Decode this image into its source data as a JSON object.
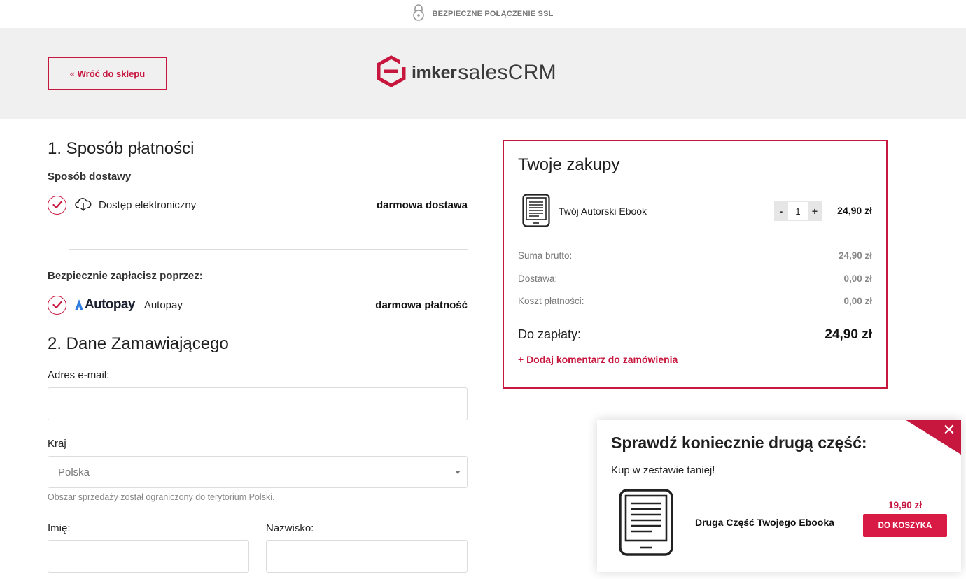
{
  "topbar": {
    "ssl_text": "BEZPIECZNE POŁĄCZENIE SSL",
    "icon": "padlock-icon"
  },
  "header": {
    "back_label": "« Wróć do sklepu",
    "logo_text_a": "imker",
    "logo_text_b": "salesCRM",
    "brand_color": "#c8173f"
  },
  "payment_section": {
    "title": "1. Sposób płatności",
    "delivery_label": "Sposób dostawy",
    "delivery_option": {
      "label": "Dostęp elektroniczny",
      "price": "darmowa dostawa",
      "icon": "cloud-download-icon"
    },
    "pay_label": "Bezpiecznie zapłacisz poprzez:",
    "pay_option": {
      "logo_text": "Autopay",
      "label": "Autopay",
      "price": "darmowa płatność"
    }
  },
  "customer_section": {
    "title": "2. Dane Zamawiającego",
    "email_label": "Adres e-mail:",
    "email_value": "",
    "country_label": "Kraj",
    "country_value": "Polska",
    "country_hint": "Obszar sprzedaży został ograniczony do terytorium Polski.",
    "first_name_label": "Imię:",
    "last_name_label": "Nazwisko:"
  },
  "cart": {
    "title": "Twoje zakupy",
    "product": {
      "name": "Twój Autorski Ebook",
      "qty": "1",
      "price": "24,90 zł",
      "minus": "-",
      "plus": "+"
    },
    "summary": [
      {
        "label": "Suma brutto:",
        "value": "24,90 zł"
      },
      {
        "label": "Dostawa:",
        "value": "0,00 zł"
      },
      {
        "label": "Koszt płatności:",
        "value": "0,00 zł"
      }
    ],
    "total_label": "Do zapłaty:",
    "total_value": "24,90 zł",
    "comment_link": "+ Dodaj komentarz do zamówienia"
  },
  "popup": {
    "title": "Sprawdź koniecznie drugą część:",
    "subtitle": "Kup w zestawie taniej!",
    "product_name": "Druga Część Twojego Ebooka",
    "price": "19,90 zł",
    "button": "DO KOSZYKA",
    "close": "✕"
  }
}
